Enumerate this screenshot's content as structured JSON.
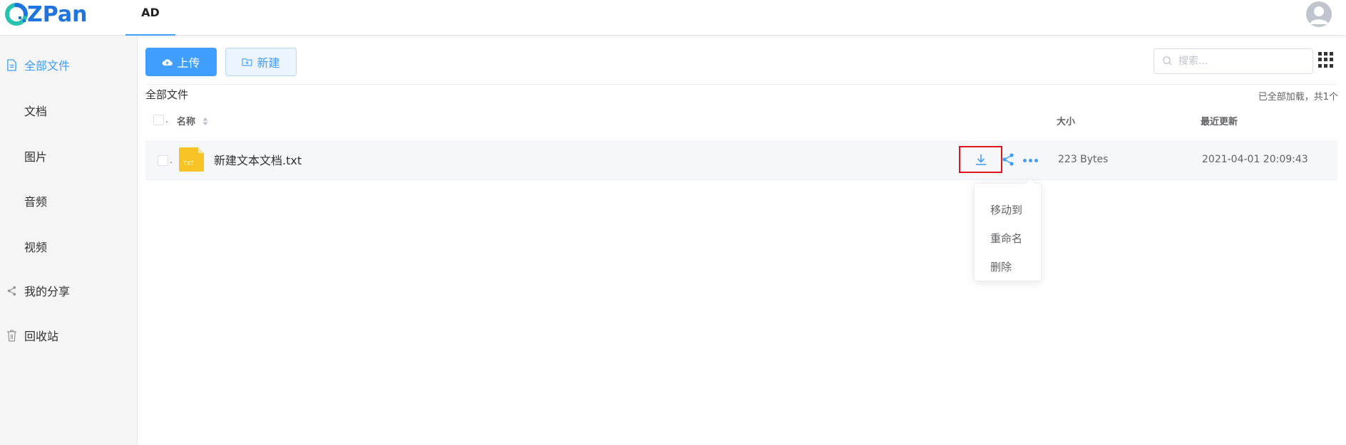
{
  "brand": {
    "name": "ZPan",
    "accent": "#1f74e0"
  },
  "header": {
    "tabs": [
      {
        "label": "AD",
        "active": true
      }
    ]
  },
  "sidebar": {
    "items": [
      {
        "label": "全部文件",
        "icon": "document-icon",
        "active": true
      },
      {
        "label": "文档",
        "icon": "",
        "active": false
      },
      {
        "label": "图片",
        "icon": "",
        "active": false
      },
      {
        "label": "音频",
        "icon": "",
        "active": false
      },
      {
        "label": "视频",
        "icon": "",
        "active": false
      },
      {
        "label": "我的分享",
        "icon": "share-icon",
        "active": false
      },
      {
        "label": "回收站",
        "icon": "trash-icon",
        "active": false
      }
    ]
  },
  "toolbar": {
    "upload_label": "上传",
    "new_label": "新建",
    "search_placeholder": "搜索..."
  },
  "breadcrumb": "全部文件",
  "summary": "已全部加载，共1个",
  "table": {
    "columns": {
      "name": "名称",
      "size": "大小",
      "updated": "最近更新"
    },
    "rows": [
      {
        "name": "新建文本文档.txt",
        "type": "TXT",
        "size": "223 Bytes",
        "updated": "2021-04-01 20:09:43"
      }
    ]
  },
  "row_menu": {
    "items": [
      "移动到",
      "重命名",
      "删除"
    ]
  },
  "colors": {
    "primary": "#409eff",
    "highlight_box": "#e0141b",
    "file_icon": "#f7c325"
  }
}
